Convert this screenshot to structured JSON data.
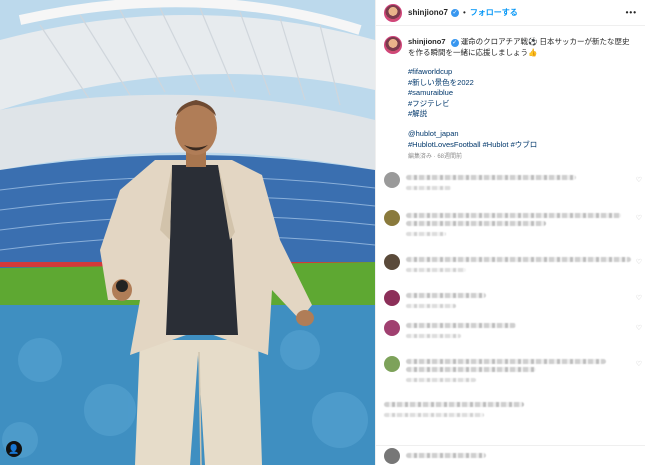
{
  "post": {
    "username": "shinjiono7",
    "follow_label": "フォローする",
    "more_label": "•••",
    "dot": "•",
    "verified_mark": "✓",
    "caption_text": "運命のクロアチア戦⚽ 日本サッカーが新たな歴史を作る瞬間を一緒に応援しましょう👍",
    "hashtags": [
      "#fifaworldcup",
      "#新しい景色を2022",
      "#samuraiblue",
      "#フジテレビ",
      "#解説"
    ],
    "mentions_line1": "@hublot_japan",
    "mentions_line2": "#HublotLovesFootball #Hublot #ウブロ",
    "meta": "編集済み · 68週間前",
    "photo_tag_icon": "👤"
  },
  "comments": [
    {
      "avatar_color": "#9a9a9a"
    },
    {
      "avatar_color": "#8a7a3c"
    },
    {
      "avatar_color": "#5a4a3a"
    },
    {
      "avatar_color": "#8c2f59"
    },
    {
      "avatar_color": "#a04070"
    },
    {
      "avatar_color": "#7da25a"
    }
  ],
  "colors": {
    "link": "#00376b",
    "follow": "#0095f6",
    "verified": "#3897f0"
  }
}
